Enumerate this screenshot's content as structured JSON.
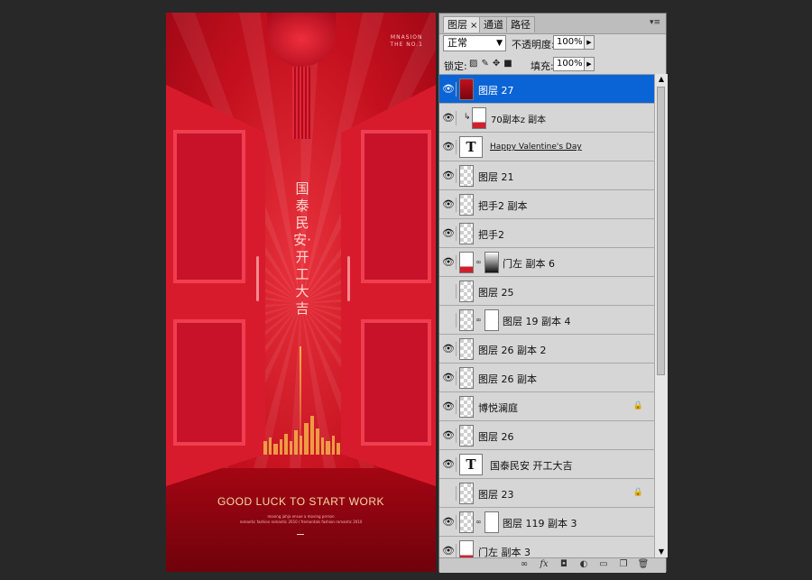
{
  "poster": {
    "brand_line1": "MNASION",
    "brand_line2": "THE NO.1",
    "vertical_text": "国泰民安·开工大吉",
    "headline": "GOOD LUCK TO START WORK",
    "small_line1": "moving jahja ensue a moving person",
    "small_line2": "romantic fashion romantic 2010 / fremontals fashion romantic 2010"
  },
  "layers_panel": {
    "tabs": [
      {
        "label": "图层",
        "active": true
      },
      {
        "label": "通道",
        "active": false
      },
      {
        "label": "路径",
        "active": false
      }
    ],
    "blend_mode": "正常",
    "opacity_label": "不透明度:",
    "opacity_value": "100%",
    "lock_label": "锁定:",
    "fill_label": "填充:",
    "fill_value": "100%",
    "layers": [
      {
        "name": "图层 27",
        "visible": true,
        "selected": true,
        "thumb": "red",
        "type": "pixel"
      },
      {
        "name": "70副本z 副本",
        "visible": true,
        "thumb": "redbottom",
        "type": "clipped"
      },
      {
        "name": "Happy Valentine's Day",
        "visible": true,
        "type": "text"
      },
      {
        "name": "图层 21",
        "visible": true,
        "thumb": "checker",
        "type": "pixel"
      },
      {
        "name": "把手2 副本",
        "visible": true,
        "thumb": "checker",
        "type": "pixel"
      },
      {
        "name": "把手2",
        "visible": true,
        "thumb": "checker",
        "type": "pixel"
      },
      {
        "name": "门左 副本 6",
        "visible": true,
        "thumb": "checker",
        "type": "masked",
        "mask": "gradient"
      },
      {
        "name": "图层 25",
        "visible": false,
        "thumb": "checker",
        "type": "pixel"
      },
      {
        "name": "图层 19 副本 4",
        "visible": false,
        "thumb": "checker",
        "type": "masked",
        "mask": "shape"
      },
      {
        "name": "图层 26 副本 2",
        "visible": true,
        "thumb": "checker",
        "type": "pixel"
      },
      {
        "name": "图层 26 副本",
        "visible": true,
        "thumb": "checker",
        "type": "pixel"
      },
      {
        "name": "博悦澜庭",
        "visible": true,
        "thumb": "checker",
        "type": "pixel",
        "locked": true
      },
      {
        "name": "图层 26",
        "visible": true,
        "thumb": "checker",
        "type": "pixel"
      },
      {
        "name": "国泰民安 开工大吉",
        "visible": true,
        "type": "text"
      },
      {
        "name": "图层 23",
        "visible": false,
        "thumb": "checker",
        "type": "pixel",
        "locked": true
      },
      {
        "name": "图层 119 副本 3",
        "visible": true,
        "thumb": "checker",
        "type": "masked",
        "mask": "shape"
      },
      {
        "name": "门左 副本 3",
        "visible": true,
        "thumb": "redbottom",
        "type": "pixel"
      }
    ],
    "icons": {
      "eye": "eye-icon",
      "lock": "lock-icon",
      "link_layers": "link-icon",
      "fx": "fx-icon",
      "mask": "add-mask-icon",
      "adjustment": "adjustment-layer-icon",
      "group": "new-group-icon",
      "new_layer": "new-layer-icon",
      "delete": "trash-icon"
    },
    "accent_color": "#0a64d6"
  }
}
